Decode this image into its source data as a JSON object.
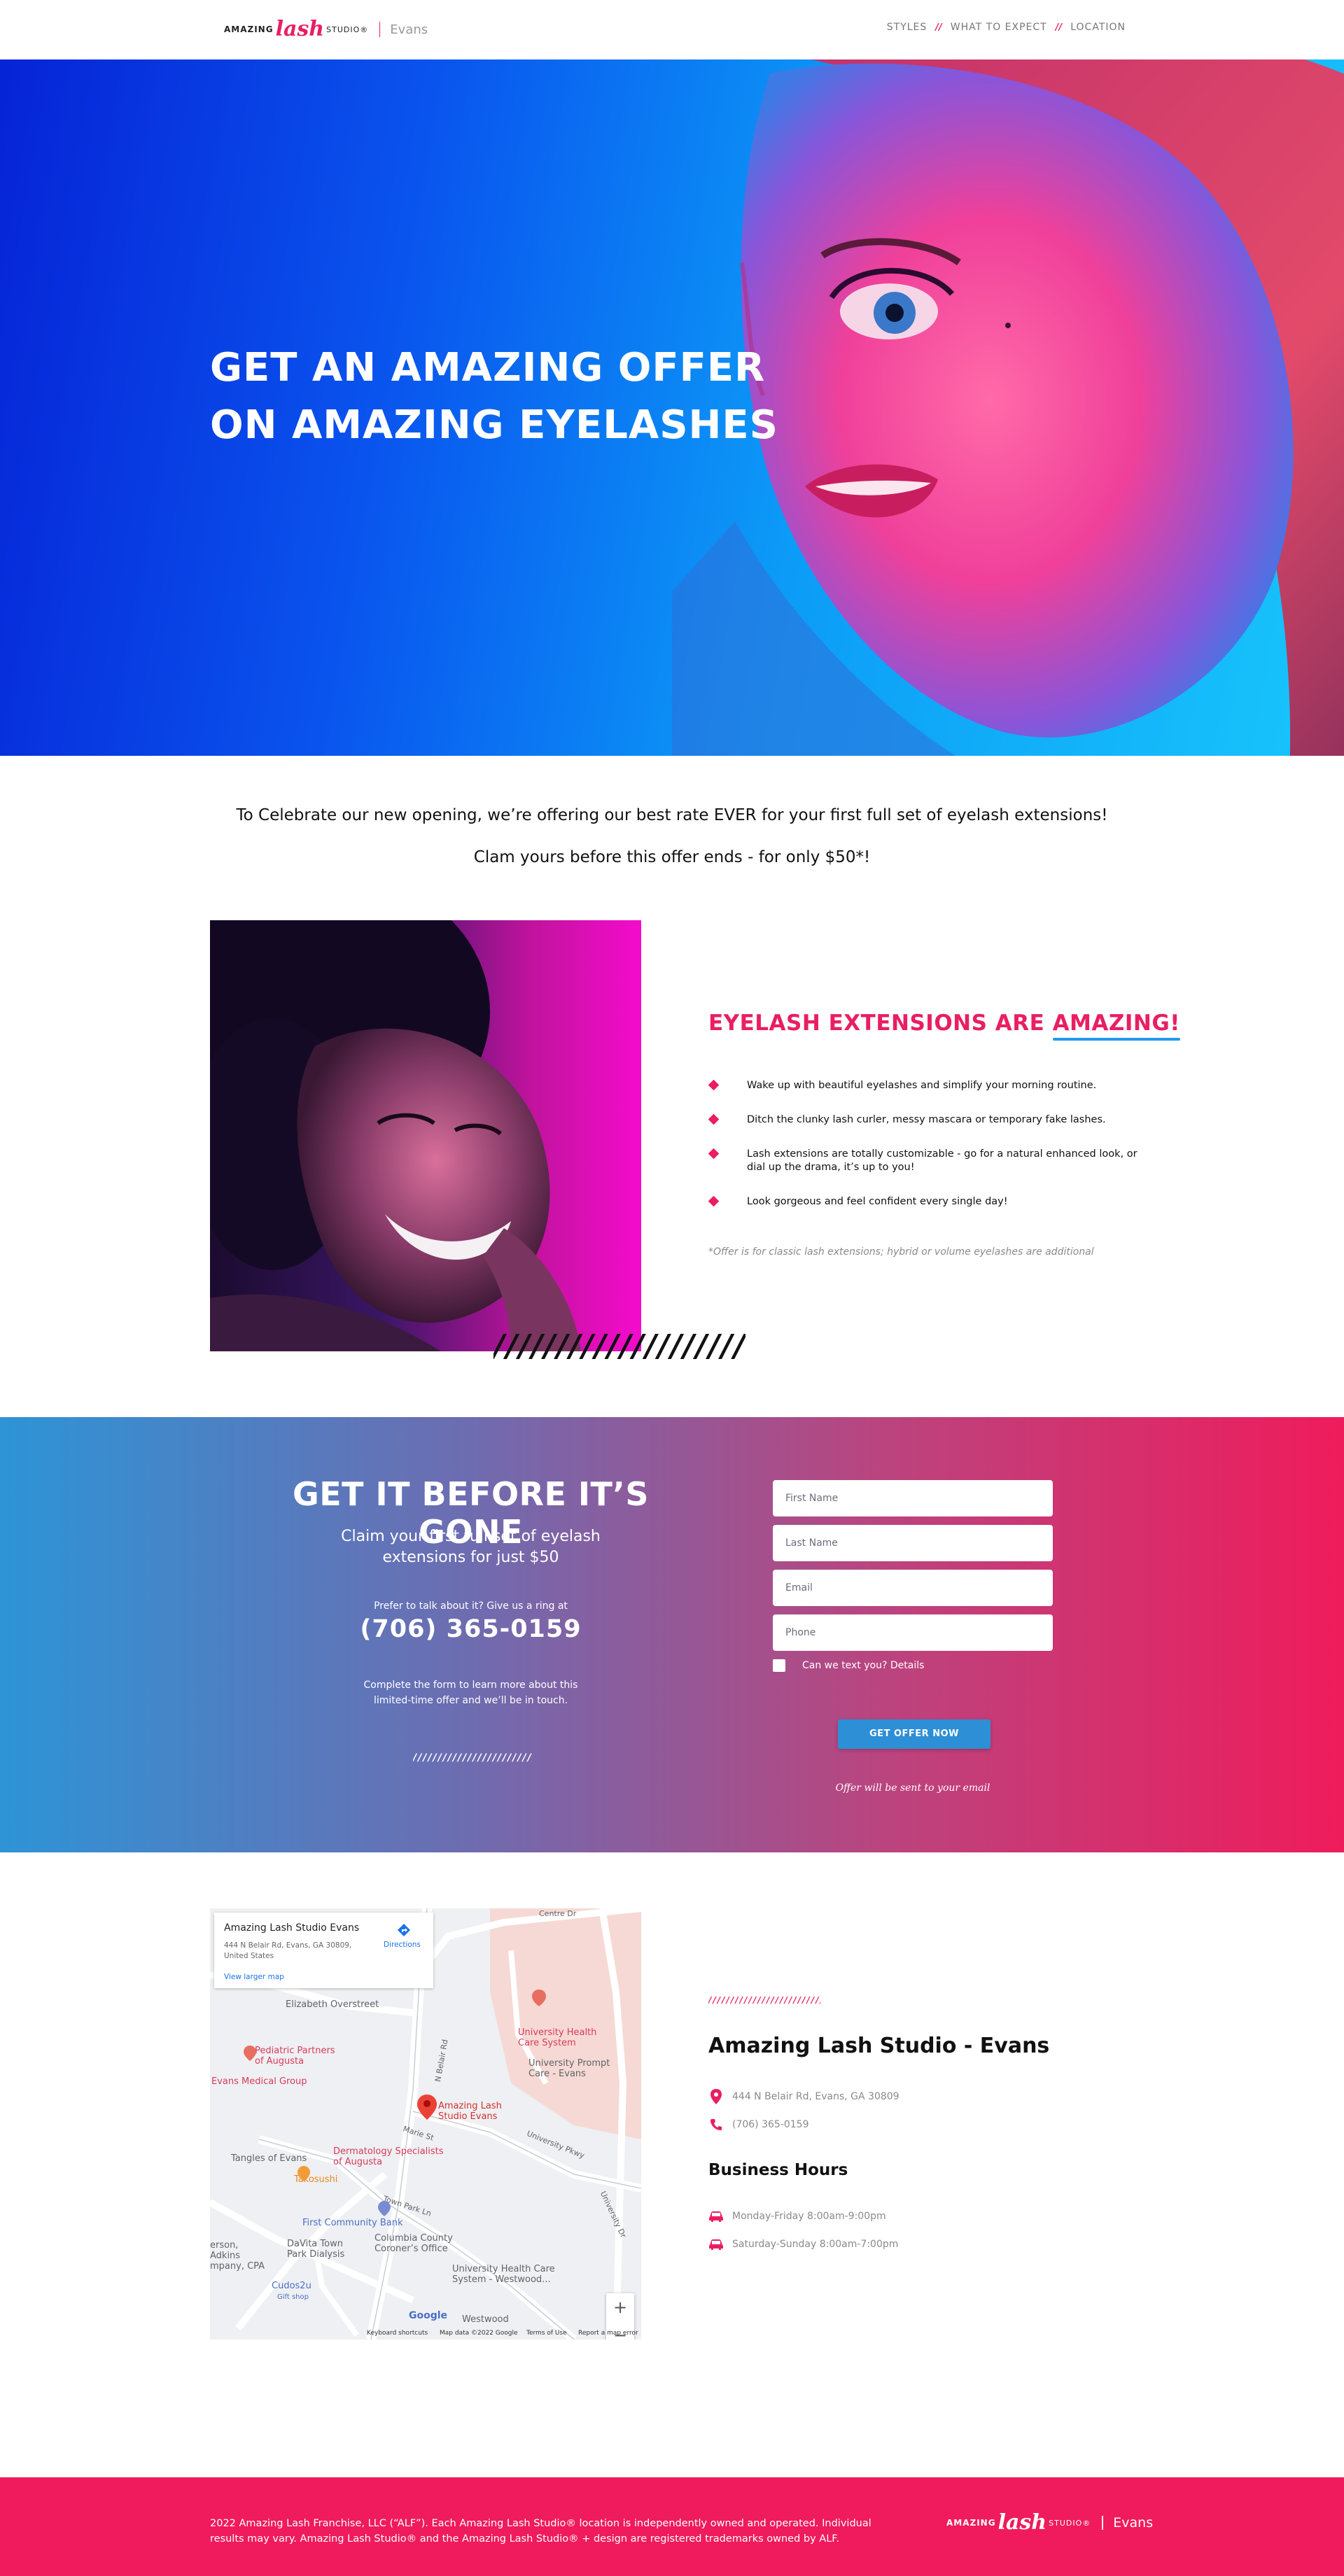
{
  "header": {
    "logo": {
      "amazing": "AMAZING",
      "lash": "lash",
      "studio": "STUDIO®",
      "location": "Evans"
    },
    "nav": [
      {
        "label": "STYLES"
      },
      {
        "label": "WHAT TO EXPECT"
      },
      {
        "label": "LOCATION"
      }
    ],
    "nav_separator": "//"
  },
  "hero": {
    "title_line1": "GET AN AMAZING OFFER",
    "title_line2": "ON AMAZING EYELASHES"
  },
  "promo": {
    "line1": "To Celebrate our new opening, we’re offering our best rate EVER for your first full set of eyelash extensions!",
    "line2": "Clam yours before this offer ends -  for only $50*!"
  },
  "feature": {
    "title_prefix": "EYELASH EXTENSIONS ARE ",
    "title_highlight": "AMAZING!",
    "decor_slashes": "////////////////////",
    "bullets": [
      "Wake up with beautiful eyelashes and simplify your morning routine.",
      "Ditch the clunky lash curler, messy mascara or temporary fake lashes.",
      "Lash extensions are totally customizable - go for a natural enhanced look, or dial up the drama, it’s up to you!",
      "Look gorgeous and feel confident every single day!"
    ],
    "offer_note": "*Offer is for classic lash extensions; hybrid or volume eyelashes are additional"
  },
  "cta": {
    "title": "GET IT BEFORE IT’S GONE",
    "subtitle_line1": "Claim your first full set of eyelash",
    "subtitle_line2": "extensions for just $50",
    "prefer": "Prefer to talk about it? Give us a ring at",
    "phone": "(706) 365-0159",
    "complete_line1": "Complete the form to learn more about this",
    "complete_line2": "limited-time offer and we’ll be in touch.",
    "decor_slashes": "//////////////////////////////",
    "form": {
      "first_name_placeholder": "First Name",
      "last_name_placeholder": "Last Name",
      "email_placeholder": "Email",
      "phone_placeholder": "Phone",
      "text_consent": "Can we text you? Details",
      "submit_label": "GET OFFER NOW",
      "sent_note": "Offer will be sent to your email"
    }
  },
  "map": {
    "card_title": "Amazing Lash Studio Evans",
    "card_address": "444 N Belair Rd, Evans, GA 30809, United States",
    "card_link": "View larger map",
    "card_directions": "Directions",
    "labels": {
      "elizabeth": "Elizabeth Overstreet",
      "pediatric": "Pediatric Partners of Augusta",
      "evans_medical": "Evans Medical Group",
      "marker": "Amazing Lash Studio Evans",
      "university_health": "University Health Care System",
      "prompt_care": "University Prompt Care - Evans",
      "tangles": "Tangles of Evans",
      "derm": "Dermatology Specialists of Augusta",
      "takosushi": "Takosushi",
      "first_community": "First Community Bank",
      "davita": "DaVita Town Park Dialysis",
      "columbia": "Columbia County Coroner’s Office",
      "uhcs_westwood": "University Health Care System - Westwood...",
      "cudos": "Cudos2u",
      "gift_shop": "Gift shop",
      "adkins": "erson, Adkins mpany, CPA",
      "westwood": "Westwood",
      "n_belair": "N Belair Rd",
      "university_pkwy": "University Pkwy",
      "town_park_ln": "Town Park Ln",
      "marie_st": "Marie St",
      "centre_dr": "Centre Dr",
      "university_dr": "University Dr"
    },
    "zoom_in": "+",
    "zoom_out": "−",
    "google": "Google",
    "footer": {
      "shortcuts": "Keyboard shortcuts",
      "mapdata": "Map data ©2022 Google",
      "terms": "Terms of Use",
      "report": "Report a map error"
    }
  },
  "location": {
    "decor_slashes": "////////////////////////////",
    "name": "Amazing Lash Studio - Evans",
    "address": "444 N Belair Rd, Evans, GA 30809",
    "phone": "(706) 365-0159",
    "hours_title": "Business Hours",
    "hours": [
      "Monday-Friday 8:00am-9:00pm",
      "Saturday-Sunday 8:00am-7:00pm"
    ]
  },
  "footer": {
    "legal_line1": "2022 Amazing Lash Franchise, LLC (“ALF”). Each Amazing Lash Studio® location is independently owned and operated. Individual",
    "legal_line2": "results may vary. Amazing Lash Studio® and the Amazing Lash Studio® + design are registered trademarks owned by ALF.",
    "logo": {
      "amazing": "AMAZING",
      "lash": "lash",
      "studio": "STUDIO®",
      "location": "Evans"
    }
  },
  "colors": {
    "brand_pink": "#e91e63",
    "accent_blue": "#2196f3",
    "hero_blue": "#0a54ee",
    "footer_pink": "#ef1b5c"
  }
}
